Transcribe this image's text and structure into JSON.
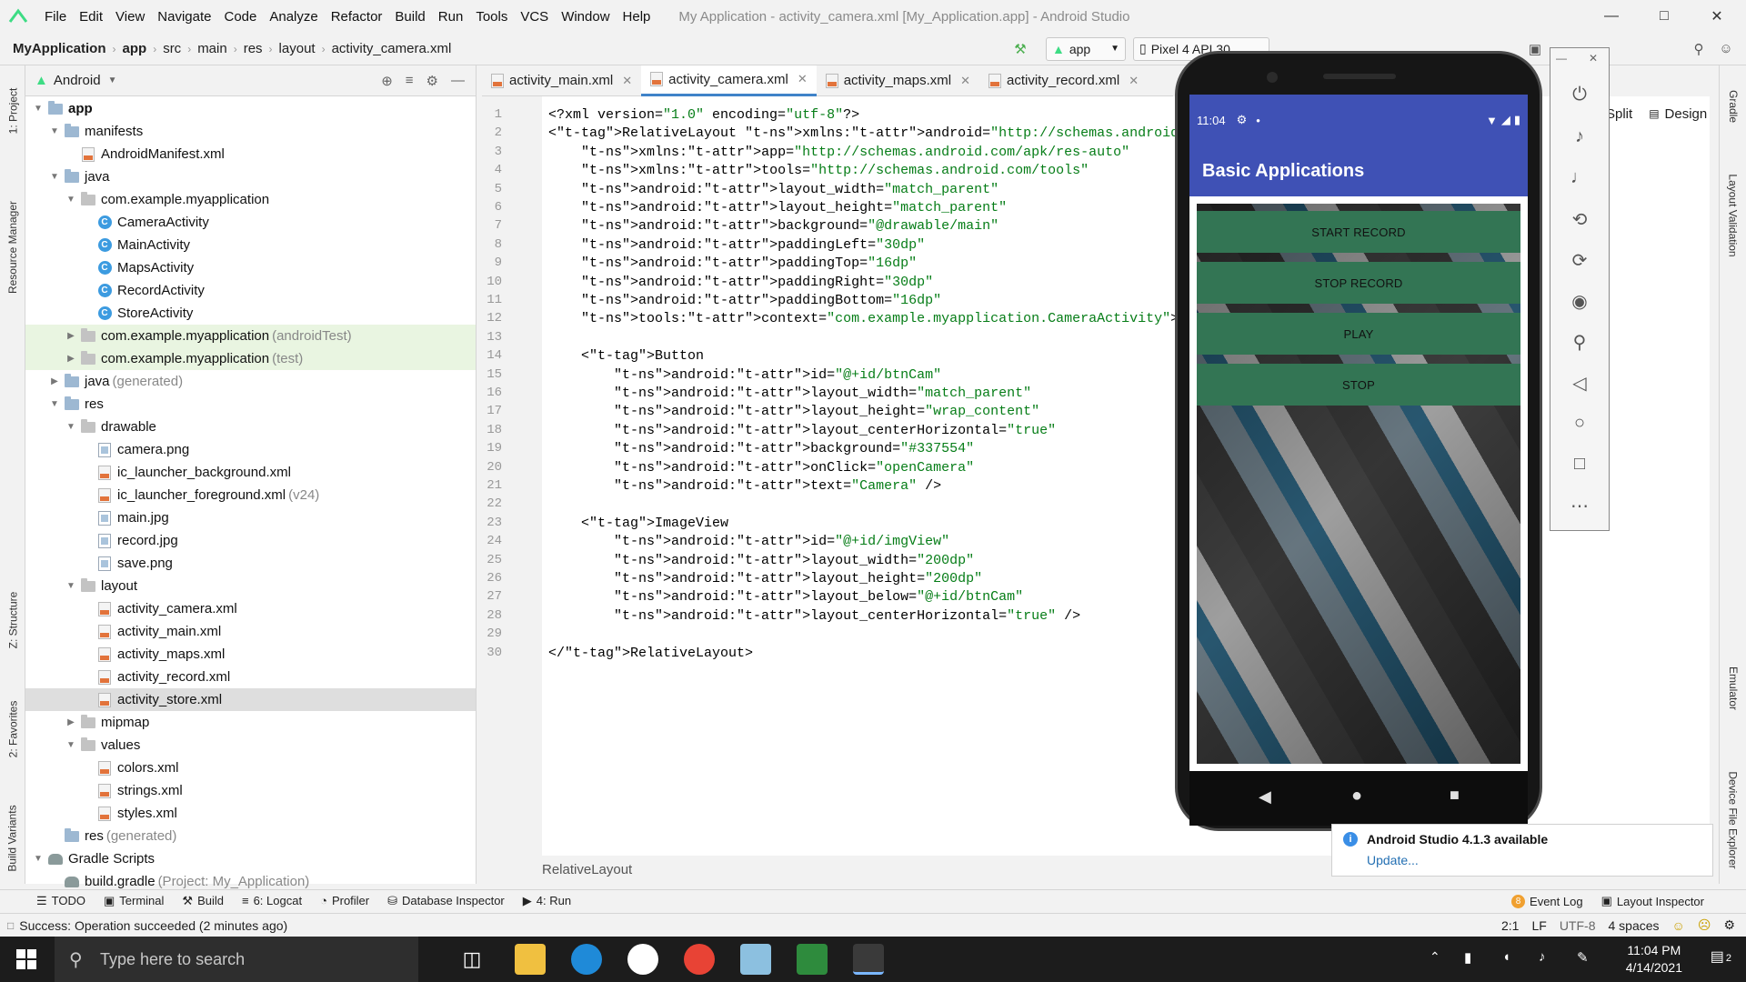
{
  "menubar": {
    "items": [
      "File",
      "Edit",
      "View",
      "Navigate",
      "Code",
      "Analyze",
      "Refactor",
      "Build",
      "Run",
      "Tools",
      "VCS",
      "Window",
      "Help"
    ],
    "window_title": "My Application - activity_camera.xml [My_Application.app] - Android Studio"
  },
  "navbar": {
    "breadcrumbs": [
      "MyApplication",
      "app",
      "src",
      "main",
      "res",
      "layout",
      "activity_camera.xml"
    ],
    "run_config": "app",
    "device": "Pixel 4 API 30"
  },
  "left_strip": {
    "tabs": [
      "1: Project",
      "Resource Manager",
      "Z: Structure",
      "2: Favorites",
      "Build Variants"
    ]
  },
  "right_strip": {
    "tabs": [
      "Gradle",
      "Layout Validation",
      "Emulator",
      "Device File Explorer"
    ]
  },
  "project": {
    "view_mode": "Android",
    "tree": [
      {
        "label": "app",
        "suffix": "",
        "icon": "folder",
        "level": 0,
        "arrow": "down",
        "bold": true
      },
      {
        "label": "manifests",
        "suffix": "",
        "icon": "folder",
        "level": 1,
        "arrow": "down"
      },
      {
        "label": "AndroidManifest.xml",
        "suffix": "",
        "icon": "manifest",
        "level": 2,
        "arrow": ""
      },
      {
        "label": "java",
        "suffix": "",
        "icon": "folder",
        "level": 1,
        "arrow": "down"
      },
      {
        "label": "com.example.myapplication",
        "suffix": "",
        "icon": "package",
        "level": 2,
        "arrow": "down"
      },
      {
        "label": "CameraActivity",
        "suffix": "",
        "icon": "class",
        "level": 3,
        "arrow": ""
      },
      {
        "label": "MainActivity",
        "suffix": "",
        "icon": "class",
        "level": 3,
        "arrow": ""
      },
      {
        "label": "MapsActivity",
        "suffix": "",
        "icon": "class",
        "level": 3,
        "arrow": ""
      },
      {
        "label": "RecordActivity",
        "suffix": "",
        "icon": "class",
        "level": 3,
        "arrow": ""
      },
      {
        "label": "StoreActivity",
        "suffix": "",
        "icon": "class",
        "level": 3,
        "arrow": ""
      },
      {
        "label": "com.example.myapplication",
        "suffix": "(androidTest)",
        "icon": "package",
        "level": 2,
        "arrow": "right",
        "highlight": true
      },
      {
        "label": "com.example.myapplication",
        "suffix": "(test)",
        "icon": "package",
        "level": 2,
        "arrow": "right",
        "highlight": true
      },
      {
        "label": "java",
        "suffix": "(generated)",
        "icon": "folder",
        "level": 1,
        "arrow": "right"
      },
      {
        "label": "res",
        "suffix": "",
        "icon": "folder",
        "level": 1,
        "arrow": "down"
      },
      {
        "label": "drawable",
        "suffix": "",
        "icon": "package",
        "level": 2,
        "arrow": "down"
      },
      {
        "label": "camera.png",
        "suffix": "",
        "icon": "image",
        "level": 3,
        "arrow": ""
      },
      {
        "label": "ic_launcher_background.xml",
        "suffix": "",
        "icon": "xml",
        "level": 3,
        "arrow": ""
      },
      {
        "label": "ic_launcher_foreground.xml",
        "suffix": "(v24)",
        "icon": "xml",
        "level": 3,
        "arrow": ""
      },
      {
        "label": "main.jpg",
        "suffix": "",
        "icon": "image",
        "level": 3,
        "arrow": ""
      },
      {
        "label": "record.jpg",
        "suffix": "",
        "icon": "image",
        "level": 3,
        "arrow": ""
      },
      {
        "label": "save.png",
        "suffix": "",
        "icon": "image",
        "level": 3,
        "arrow": ""
      },
      {
        "label": "layout",
        "suffix": "",
        "icon": "package",
        "level": 2,
        "arrow": "down"
      },
      {
        "label": "activity_camera.xml",
        "suffix": "",
        "icon": "xml",
        "level": 3,
        "arrow": ""
      },
      {
        "label": "activity_main.xml",
        "suffix": "",
        "icon": "xml",
        "level": 3,
        "arrow": ""
      },
      {
        "label": "activity_maps.xml",
        "suffix": "",
        "icon": "xml",
        "level": 3,
        "arrow": ""
      },
      {
        "label": "activity_record.xml",
        "suffix": "",
        "icon": "xml",
        "level": 3,
        "arrow": ""
      },
      {
        "label": "activity_store.xml",
        "suffix": "",
        "icon": "xml",
        "level": 3,
        "arrow": "",
        "selected": true
      },
      {
        "label": "mipmap",
        "suffix": "",
        "icon": "package",
        "level": 2,
        "arrow": "right"
      },
      {
        "label": "values",
        "suffix": "",
        "icon": "package",
        "level": 2,
        "arrow": "down"
      },
      {
        "label": "colors.xml",
        "suffix": "",
        "icon": "xml",
        "level": 3,
        "arrow": ""
      },
      {
        "label": "strings.xml",
        "suffix": "",
        "icon": "xml",
        "level": 3,
        "arrow": ""
      },
      {
        "label": "styles.xml",
        "suffix": "",
        "icon": "xml",
        "level": 3,
        "arrow": ""
      },
      {
        "label": "res",
        "suffix": "(generated)",
        "icon": "folder",
        "level": 1,
        "arrow": ""
      },
      {
        "label": "Gradle Scripts",
        "suffix": "",
        "icon": "gradle",
        "level": 0,
        "arrow": "down"
      },
      {
        "label": "build.gradle",
        "suffix": "(Project: My_Application)",
        "icon": "gradle",
        "level": 1,
        "arrow": ""
      }
    ]
  },
  "tabs": [
    {
      "label": "activity_main.xml",
      "active": false
    },
    {
      "label": "activity_camera.xml",
      "active": true
    },
    {
      "label": "activity_maps.xml",
      "active": false
    },
    {
      "label": "activity_record.xml",
      "active": false
    }
  ],
  "editor": {
    "view_modes": [
      "Split",
      "Design"
    ],
    "breadcrumb": "RelativeLayout",
    "lines": [
      "<?xml version=\"1.0\" encoding=\"utf-8\"?>",
      "<RelativeLayout xmlns:android=\"http://schemas.android.com/apk/res/android\"",
      "    xmlns:app=\"http://schemas.android.com/apk/res-auto\"",
      "    xmlns:tools=\"http://schemas.android.com/tools\"",
      "    android:layout_width=\"match_parent\"",
      "    android:layout_height=\"match_parent\"",
      "    android:background=\"@drawable/main\"",
      "    android:paddingLeft=\"30dp\"",
      "    android:paddingTop=\"16dp\"",
      "    android:paddingRight=\"30dp\"",
      "    android:paddingBottom=\"16dp\"",
      "    tools:context=\"com.example.myapplication.CameraActivity\">",
      "",
      "    <Button",
      "        android:id=\"@+id/btnCam\"",
      "        android:layout_width=\"match_parent\"",
      "        android:layout_height=\"wrap_content\"",
      "        android:layout_centerHorizontal=\"true\"",
      "        android:background=\"#337554\"",
      "        android:onClick=\"openCamera\"",
      "        android:text=\"Camera\" />",
      "",
      "    <ImageView",
      "        android:id=\"@+id/imgView\"",
      "        android:layout_width=\"200dp\"",
      "        android:layout_height=\"200dp\"",
      "        android:layout_below=\"@+id/btnCam\"",
      "        android:layout_centerHorizontal=\"true\" />",
      "",
      "</RelativeLayout>"
    ]
  },
  "emulator": {
    "time": "11:04",
    "app_title": "Basic Applications",
    "buttons": [
      "START RECORD",
      "STOP RECORD",
      "PLAY",
      "STOP"
    ],
    "button_color": "#337554",
    "appbar_color": "#3f51b5"
  },
  "notification": {
    "title": "Android Studio 4.1.3 available",
    "link": "Update..."
  },
  "bottom_tools": {
    "left": [
      "TODO",
      "Terminal",
      "Build",
      "6: Logcat",
      "Profiler",
      "Database Inspector",
      "4: Run"
    ],
    "right": [
      "Event Log",
      "Layout Inspector"
    ],
    "event_count": "8"
  },
  "status": {
    "message": "Success: Operation succeeded (2 minutes ago)",
    "position": "2:1",
    "line_sep": "LF",
    "encoding": "UTF-8",
    "indent": "4 spaces"
  },
  "taskbar": {
    "search_placeholder": "Type here to search",
    "time": "11:04 PM",
    "date": "4/14/2021",
    "notifications": "2"
  }
}
